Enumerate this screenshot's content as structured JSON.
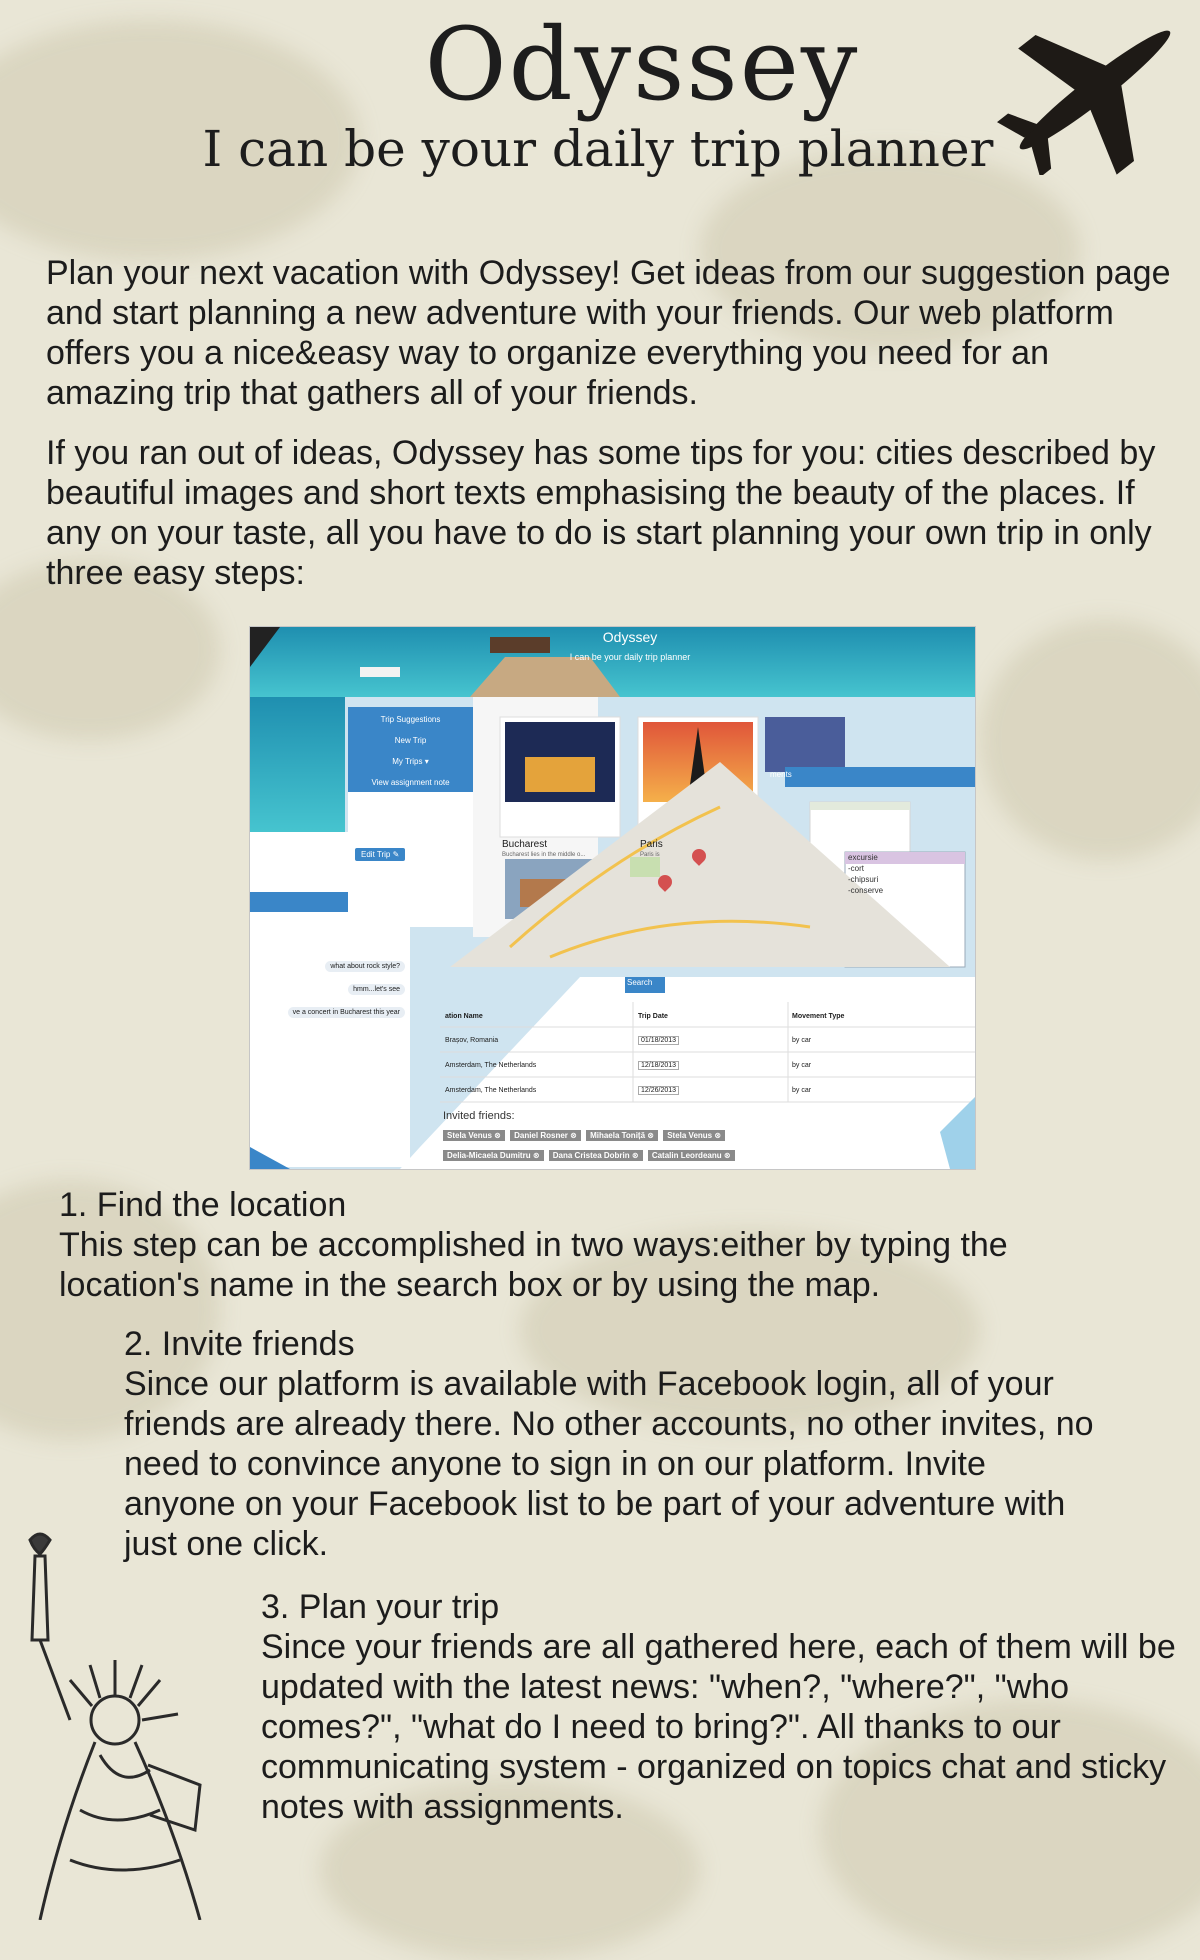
{
  "header": {
    "title": "Odyssey",
    "subtitle": "I can be your daily trip planner"
  },
  "intro": {
    "paragraph1": "Plan your next vacation with Odyssey! Get ideas from our suggestion page and start planning a new adventure with your friends. Our web platform offers you a nice&easy way to organize everything you need for an amazing trip that gathers all of your friends.",
    "paragraph2": "If you ran out of ideas, Odyssey has some tips for you: cities described by beautiful images and short texts emphasising the beauty of the places. If any on your taste, all you have to do is start planning your own trip in only three easy steps:"
  },
  "screenshot": {
    "app_title": "Odyssey",
    "app_tagline": "I can be your daily trip planner",
    "menu": [
      "Trip Suggestions",
      "New Trip",
      "My Trips ▾",
      "View assignment note"
    ],
    "edit_trip": "Edit Trip",
    "cities": [
      {
        "name": "Bucharest",
        "desc": "Bucharest lies in the middle o..."
      },
      {
        "name": "Paris",
        "desc": "Paris is"
      }
    ],
    "chat": [
      "what about rock style?",
      "hmm...let's see",
      "ve a concert in Bucharest this year"
    ],
    "comments_tab": "ments",
    "sticky_note": {
      "title": "excursie",
      "items": [
        "-cort",
        "-chipsuri",
        "-conserve"
      ]
    },
    "search_button": "Search",
    "table_headers": [
      "ation Name",
      "Trip Date",
      "Movement Type"
    ],
    "table_rows": [
      {
        "location": "Brașov, Romania",
        "date": "01/18/2013",
        "movement": "by car"
      },
      {
        "location": "Amsterdam, The Netherlands",
        "date": "12/18/2013",
        "movement": "by car"
      },
      {
        "location": "Amsterdam, The Netherlands",
        "date": "12/26/2013",
        "movement": "by car"
      }
    ],
    "invited_label": "Invited friends:",
    "friends": [
      "Stela Venus",
      "Daniel Rosner",
      "Mihaela Toniță",
      "Stela Venus",
      "Delia-Micaela Dumitru",
      "Dana Cristea Dobrin",
      "Catalin Leordeanu"
    ]
  },
  "steps": [
    {
      "title": "1. Find the location",
      "text": "This step can be accomplished in two ways:either by typing the location's name in the search box or by using the map."
    },
    {
      "title": "2. Invite friends",
      "text": "Since our platform is available with Facebook login, all of your friends are already there. No other accounts, no other invites, no need to convince anyone to sign in on our platform. Invite anyone on your Facebook list to be part of your adventure with just one click."
    },
    {
      "title": "3. Plan your trip",
      "text": "Since your friends are all gathered here, each of them will be updated with the latest news: \"when?, \"where?\", \"who comes?\", \"what do I need to bring?\". All thanks to our communicating system - organized on topics chat and sticky notes with assignments."
    }
  ],
  "icons": [
    "airplane-icon",
    "statue-of-liberty-illustration",
    "map-pin-icon",
    "remove-icon",
    "edit-icon"
  ],
  "colors": {
    "background": "#e9e6d6",
    "text": "#1c1c1c",
    "app_blue": "#3a86c8"
  }
}
